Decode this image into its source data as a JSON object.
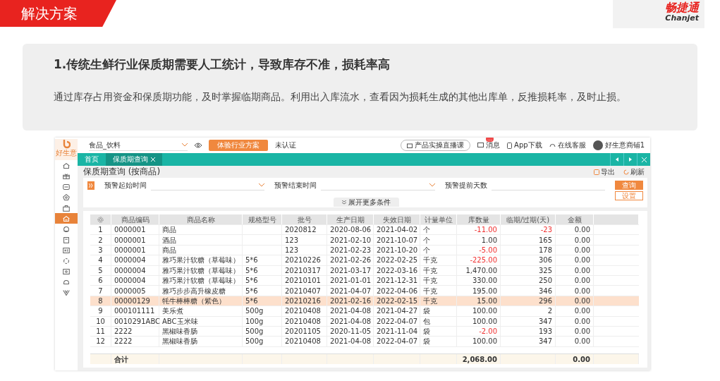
{
  "slide": {
    "title": "解决方案",
    "logo_cn": "畅捷通",
    "logo_en": "Chanjet"
  },
  "problem": {
    "heading": "1.传统生鲜行业保质期需要人工统计，导致库存不准，损耗率高",
    "text": "通过库存占用资金和保质期功能，及时掌握临期商品。利用出入库流水，查看因为损耗生成的其他出库单，反推损耗率，及时止损。"
  },
  "app": {
    "logo_text": "好生意",
    "sidebar": [
      {
        "selected": false
      },
      {
        "selected": false
      },
      {
        "selected": false
      },
      {
        "selected": false
      },
      {
        "selected": false
      },
      {
        "selected": true
      },
      {
        "selected": false
      },
      {
        "selected": false
      },
      {
        "selected": false
      },
      {
        "selected": false
      },
      {
        "selected": false
      },
      {
        "selected": false
      },
      {
        "selected": false
      }
    ],
    "org": "食品_饮料",
    "promo_button": "体验行业方案",
    "cert": "未认证",
    "live_link": "产品实操直播课",
    "messages": "消息",
    "message_badge": "…",
    "app_download": "App下载",
    "service": "在线客服",
    "user": "好生意商铺1",
    "tabs": [
      {
        "label": "首页",
        "selected": false,
        "closable": false
      },
      {
        "label": "保质期查询",
        "selected": true,
        "closable": true
      }
    ],
    "page_title": "保质期查询 (按商品)",
    "export": "导出",
    "refresh": "刷新",
    "filters": [
      {
        "label": "预警起始时间",
        "kind": "dropdown"
      },
      {
        "label": "预警结束时间",
        "kind": "dropdown"
      },
      {
        "label": "预警提前天数",
        "kind": "text"
      }
    ],
    "query_button": "查询",
    "settings_button": "设置",
    "more_filters": "展开更多条件",
    "columns": [
      "商品编码",
      "商品名称",
      "规格型号",
      "批号",
      "生产日期",
      "失效日期",
      "计量单位",
      "库数量",
      "临期/过期(天)",
      "金额"
    ],
    "rows": [
      {
        "index": "1",
        "cells": [
          "0000001",
          "商品",
          "",
          "2020812",
          "2020-08-06",
          "2021-04-02",
          "个",
          "-11.00",
          "-23",
          "0.00"
        ],
        "selected": false,
        "qty_negative": true,
        "days_negative": true
      },
      {
        "index": "2",
        "cells": [
          "0000001",
          "酒品",
          "",
          "123",
          "2021-02-10",
          "2021-10-07",
          "个",
          "1.00",
          "165",
          "0.00"
        ],
        "selected": false,
        "qty_negative": false,
        "days_negative": false
      },
      {
        "index": "3",
        "cells": [
          "0000001",
          "商品",
          "",
          "123",
          "2021-02-23",
          "2021-10-20",
          "个",
          "-5.00",
          "178",
          "0.00"
        ],
        "selected": false,
        "qty_negative": true,
        "days_negative": false
      },
      {
        "index": "4",
        "cells": [
          "0000004",
          "雅巧果汁软糖（草莓味）",
          "5*6",
          "20210226",
          "2021-02-26",
          "2022-02-25",
          "千克",
          "-225.00",
          "306",
          "0.00"
        ],
        "selected": false,
        "qty_negative": true,
        "days_negative": false
      },
      {
        "index": "5",
        "cells": [
          "0000004",
          "雅巧果汁软糖（草莓味）",
          "5*6",
          "20210317",
          "2021-03-17",
          "2022-03-16",
          "千克",
          "1,470.00",
          "325",
          "0.00"
        ],
        "selected": false,
        "qty_negative": false,
        "days_negative": false
      },
      {
        "index": "6",
        "cells": [
          "0000004",
          "雅巧果汁软糖（草莓味）",
          "5*6",
          "20210101",
          "2021-01-01",
          "2021-12-31",
          "千克",
          "330.00",
          "250",
          "0.00"
        ],
        "selected": false,
        "qty_negative": false,
        "days_negative": false
      },
      {
        "index": "7",
        "cells": [
          "0000005",
          "雅巧步步高升橡皮糖",
          "5*6",
          "20210407",
          "2021-04-07",
          "2022-04-06",
          "千克",
          "195.00",
          "346",
          "0.00"
        ],
        "selected": false,
        "qty_negative": false,
        "days_negative": false
      },
      {
        "index": "8",
        "cells": [
          "00000129",
          "牦牛棒棒糖（紫色）",
          "5*6",
          "20210216",
          "2021-02-16",
          "2022-02-15",
          "千克",
          "15.00",
          "296",
          "0.00"
        ],
        "selected": true,
        "qty_negative": false,
        "days_negative": false
      },
      {
        "index": "9",
        "cells": [
          "000101111",
          "美乐煮",
          "500g",
          "20210408",
          "2021-04-08",
          "2021-04-27",
          "袋",
          "100.00",
          "2",
          "0.00"
        ],
        "selected": false,
        "qty_negative": false,
        "days_negative": false
      },
      {
        "index": "10",
        "cells": [
          "0010291ABC",
          "ABC玉米味",
          "100g",
          "20210408",
          "2021-04-08",
          "2022-04-07",
          "包",
          "100.00",
          "347",
          "0.00"
        ],
        "selected": false,
        "qty_negative": false,
        "days_negative": false
      },
      {
        "index": "11",
        "cells": [
          "2222",
          "黑椒味香肠",
          "500g",
          "20201105",
          "2020-11-05",
          "2021-11-04",
          "袋",
          "-2.00",
          "193",
          "0.00"
        ],
        "selected": false,
        "qty_negative": true,
        "days_negative": false
      },
      {
        "index": "12",
        "cells": [
          "2222",
          "黑椒味香肠",
          "500g",
          "20210408",
          "2021-04-08",
          "2022-04-07",
          "袋",
          "100.00",
          "347",
          "0.00"
        ],
        "selected": false,
        "qty_negative": false,
        "days_negative": false
      }
    ],
    "total_label": "合计",
    "total_qty": "2,068.00",
    "total_amount": "0.00"
  }
}
